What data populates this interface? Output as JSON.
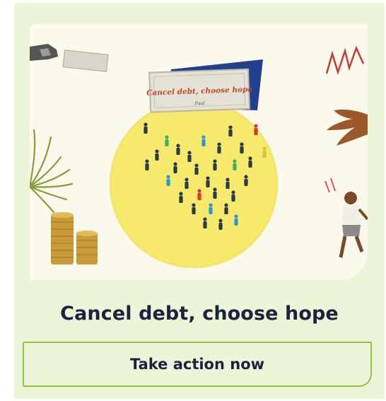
{
  "card": {
    "headline": "Cancel debt, choose hope",
    "cta_label": "Take action now",
    "colors": {
      "card_bg": "#edf5d8",
      "headline": "#1c2340",
      "cta_border": "#93c23c",
      "sun": "#f5e86a"
    }
  },
  "illustration": {
    "banner_text": "Cancel debt, choose hope",
    "banner_signature": "Paul"
  }
}
